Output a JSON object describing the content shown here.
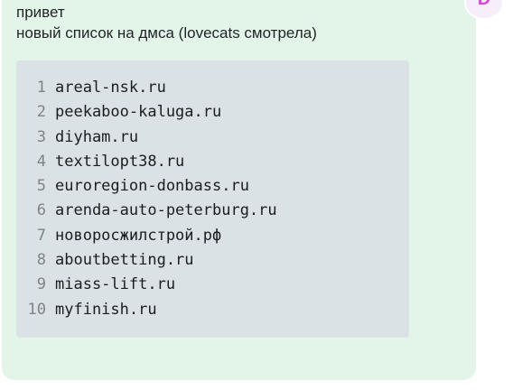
{
  "avatar": {
    "initial": "D"
  },
  "message": {
    "lines": [
      "привет",
      "новый список на дмса (lovecats смотрела)"
    ]
  },
  "code_block": {
    "lines": [
      {
        "num": "1",
        "text": "areal-nsk.ru"
      },
      {
        "num": "2",
        "text": "peekaboo-kaluga.ru"
      },
      {
        "num": "3",
        "text": "diyham.ru"
      },
      {
        "num": "4",
        "text": "textilopt38.ru"
      },
      {
        "num": "5",
        "text": "euroregion-donbass.ru"
      },
      {
        "num": "6",
        "text": "arenda-auto-peterburg.ru"
      },
      {
        "num": "7",
        "text": "новоросжилстрой.рф"
      },
      {
        "num": "8",
        "text": "aboutbetting.ru"
      },
      {
        "num": "9",
        "text": "miass-lift.ru"
      },
      {
        "num": "10",
        "text": "myfinish.ru"
      }
    ]
  },
  "colors": {
    "bubble_bg": "#e3f5e9",
    "code_bg": "#dbe2e6",
    "avatar_accent": "#d24ad8",
    "text": "#1f2328",
    "line_number": "#7d8388"
  }
}
